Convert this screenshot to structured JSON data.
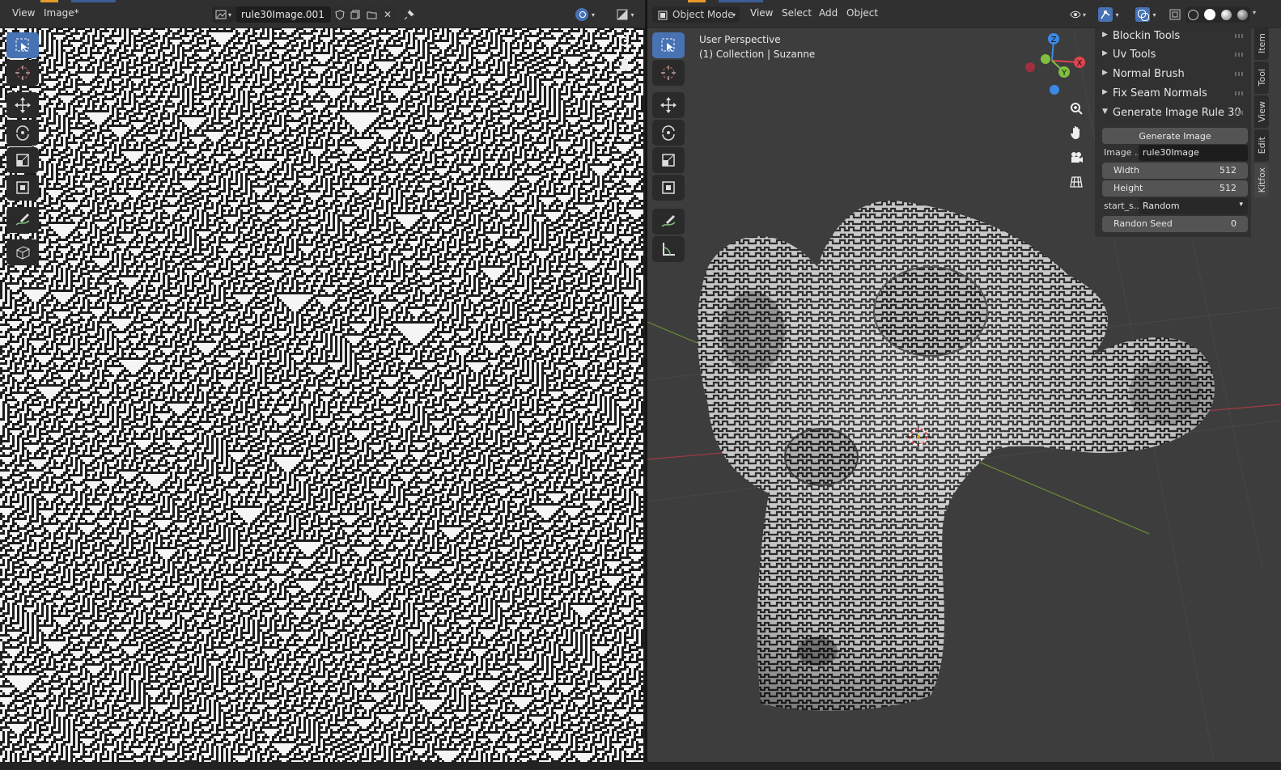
{
  "image_editor": {
    "menu": [
      "View",
      "Image*"
    ],
    "image_name": "rule30Image.001",
    "rule": 30
  },
  "viewport": {
    "mode": "Object Mode",
    "menu": [
      "View",
      "Select",
      "Add",
      "Object"
    ],
    "perspective": "User Perspective",
    "collection": "(1) Collection | Suzanne",
    "axes": {
      "z": "Z",
      "y": "Y",
      "x": "X"
    }
  },
  "npanel": {
    "panels": [
      {
        "label": "Blockin Tools",
        "expanded": false
      },
      {
        "label": "Uv Tools",
        "expanded": false
      },
      {
        "label": "Normal Brush",
        "expanded": false
      },
      {
        "label": "Fix Seam Normals",
        "expanded": false
      },
      {
        "label": "Generate Image Rule 30",
        "expanded": true
      }
    ],
    "generate_button": "Generate Image",
    "image_label": "Image ...",
    "image_value": "rule30Image",
    "width_label": "Width",
    "width_value": "512",
    "height_label": "Height",
    "height_value": "512",
    "start_label": "start_s...",
    "start_value": "Random",
    "seed_label": "Randon Seed",
    "seed_value": "0"
  },
  "sidebar_tabs": [
    "Item",
    "Tool",
    "View",
    "Edit",
    "Kitfox"
  ],
  "colors": {
    "accent": "#4772b3",
    "header": "#303030",
    "viewport_bg": "#3d3d3d",
    "axis_x": "#e2434e",
    "axis_y": "#7fbf3f",
    "axis_z": "#3c8ae6"
  }
}
